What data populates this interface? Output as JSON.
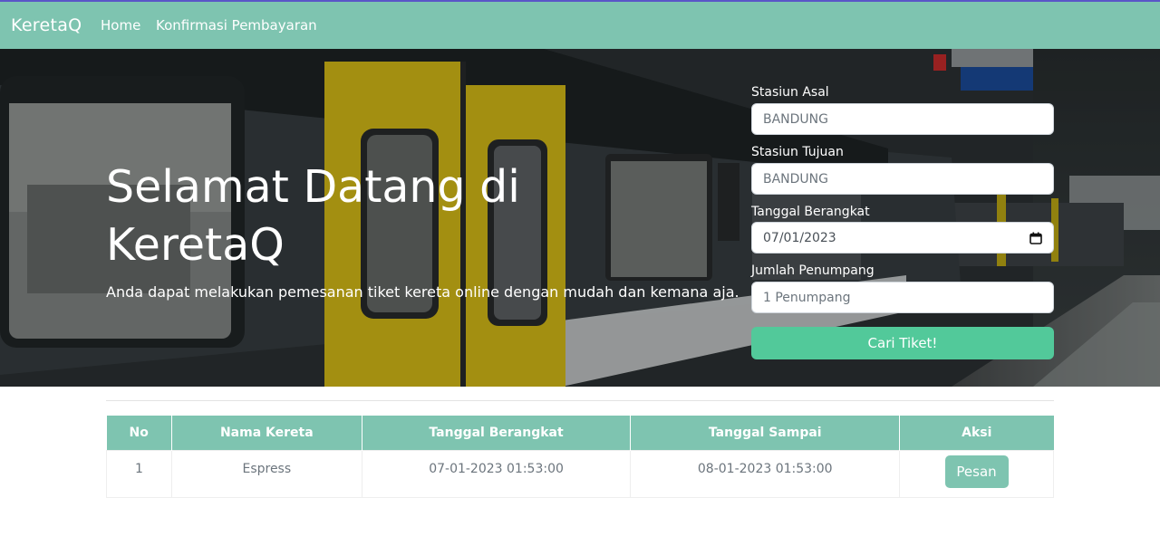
{
  "navbar": {
    "brand": "KeretaQ",
    "links": [
      "Home",
      "Konfirmasi Pembayaran"
    ]
  },
  "hero": {
    "title": "Selamat Datang di KeretaQ",
    "subtitle": "Anda dapat melakukan pemesanan tiket kereta online dengan mudah dan kemana aja."
  },
  "form": {
    "asal_label": "Stasiun Asal",
    "asal_value": "BANDUNG",
    "tujuan_label": "Stasiun Tujuan",
    "tujuan_value": "BANDUNG",
    "tanggal_label": "Tanggal Berangkat",
    "tanggal_value": "07/01/2023",
    "penumpang_label": "Jumlah Penumpang",
    "penumpang_value": "1 Penumpang",
    "submit_label": "Cari Tiket!"
  },
  "table": {
    "headers": [
      "No",
      "Nama Kereta",
      "Tanggal Berangkat",
      "Tanggal Sampai",
      "Aksi"
    ],
    "rows": [
      {
        "no": "1",
        "nama": "Espress",
        "berangkat": "07-01-2023 01:53:00",
        "sampai": "08-01-2023 01:53:00",
        "aksi": "Pesan"
      }
    ]
  },
  "colors": {
    "navbar": "#7ec4b0",
    "button_primary": "#52c99a",
    "table_header": "#7ec4b0",
    "train_yellow": "#e2c618"
  },
  "icons": {
    "date_picker": "calendar-icon"
  }
}
